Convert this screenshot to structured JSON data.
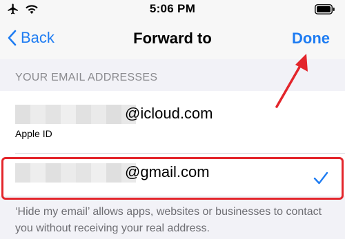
{
  "status_bar": {
    "time": "5:06 PM",
    "icons": [
      "airplane-icon",
      "wifi-icon",
      "battery-icon"
    ]
  },
  "navbar": {
    "back_label": "Back",
    "title": "Forward to",
    "done_label": "Done"
  },
  "section_header": "YOUR EMAIL ADDRESSES",
  "emails": [
    {
      "domain": "@icloud.com",
      "sublabel": "Apple ID",
      "selected": false
    },
    {
      "domain": "@gmail.com",
      "sublabel": "",
      "selected": true
    }
  ],
  "footer_text": "‘Hide my email’ allows apps, websites or businesses to contact you without receiving your real address.",
  "colors": {
    "accent": "#1e7cf2",
    "annotation": "#e3252b",
    "background": "#f2f2f7"
  }
}
